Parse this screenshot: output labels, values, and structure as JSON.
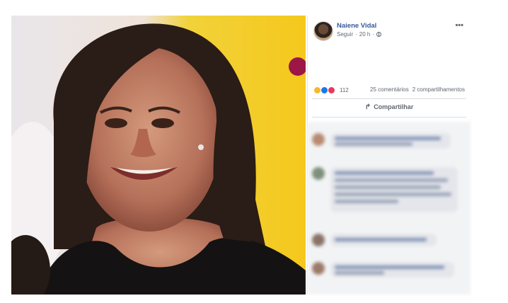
{
  "post": {
    "author": "Naiene Vidal",
    "follow_label": "Seguir",
    "separator": "·",
    "time": "20 h",
    "more": "•••",
    "reactions_count": "112",
    "comments": "25 comentários",
    "shares": "2 compartilhamentos",
    "share_button": "Compartilhar",
    "share_icon": "↱"
  },
  "icons": {
    "avatar": "avatar-icon",
    "privacy": "globe-icon",
    "reactions": [
      "haha-icon",
      "like-icon",
      "love-icon"
    ],
    "share": "share-icon"
  },
  "colors": {
    "author_link": "#385898",
    "like": "#1877f2",
    "love": "#e8395c",
    "haha": "#f7b928"
  }
}
